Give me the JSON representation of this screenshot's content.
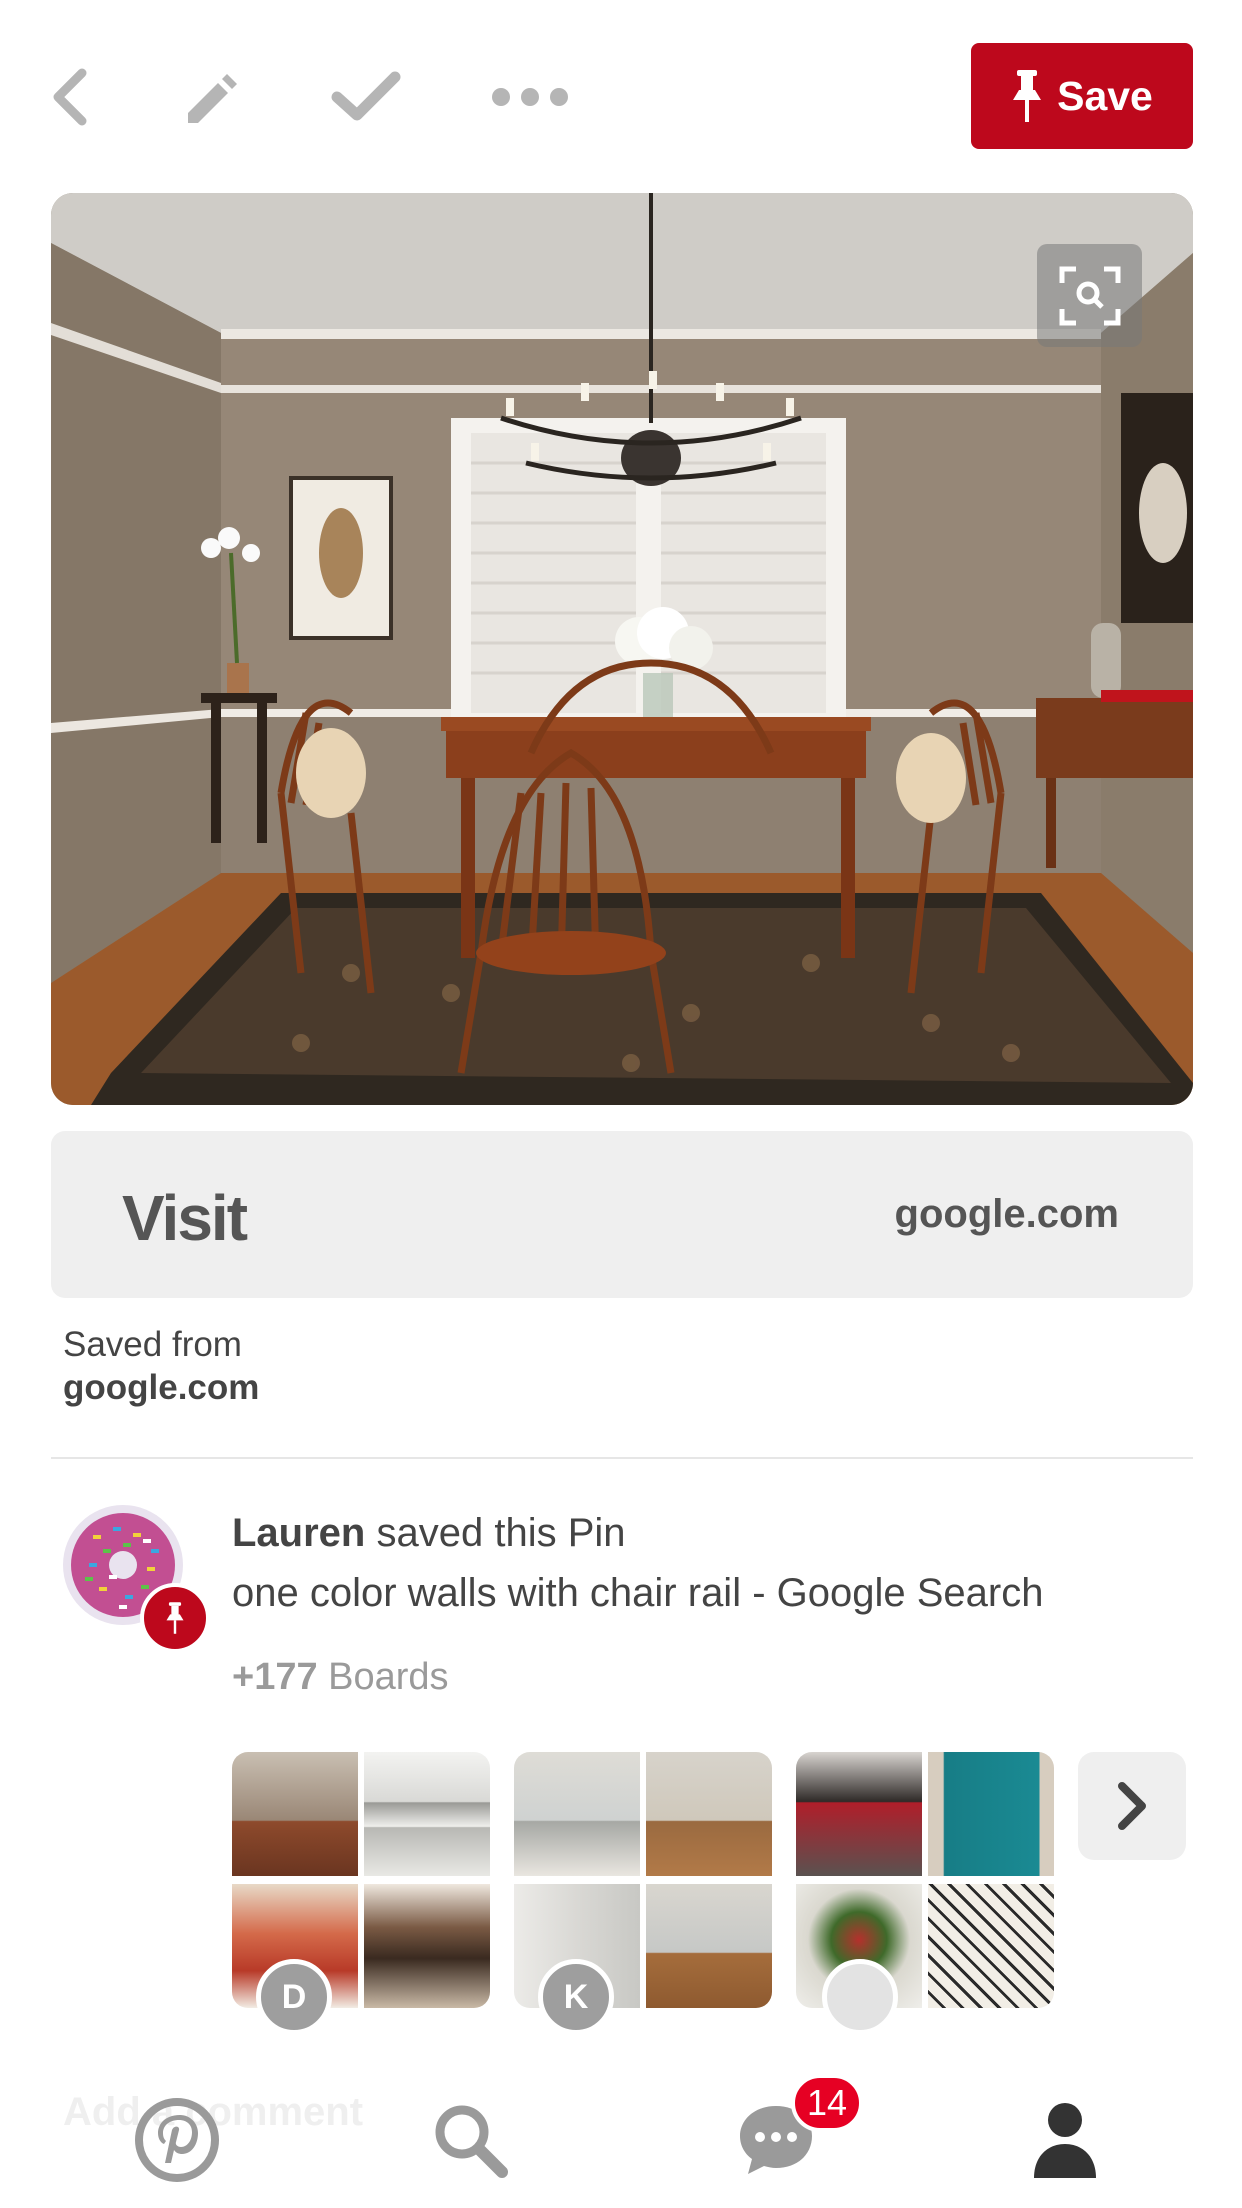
{
  "topbar": {
    "icons": [
      "back-chevron-icon",
      "edit-pencil-icon",
      "checkmark-icon",
      "more-dots-icon"
    ],
    "save_label": "Save",
    "accent": "#bd081c"
  },
  "pin": {
    "image_alt": "Dining room with one color walls and chair rail",
    "lens_icon": "visual-search-icon"
  },
  "visit": {
    "label": "Visit",
    "domain": "google.com"
  },
  "source": {
    "saved_from": "Saved from",
    "domain": "google.com"
  },
  "activity": {
    "user": "Lauren",
    "action": "saved this Pin",
    "title": "one color walls with chair rail - Google Search",
    "boards_count": "+177",
    "boards_label": "Boards"
  },
  "boards": [
    {
      "initial": "D"
    },
    {
      "initial": "K"
    },
    {
      "initial": ""
    }
  ],
  "bottom": {
    "ghost_text": "Add a comment",
    "notification_count": "14",
    "icons": [
      "pinterest-home-icon",
      "search-icon",
      "messages-icon",
      "profile-icon"
    ]
  }
}
